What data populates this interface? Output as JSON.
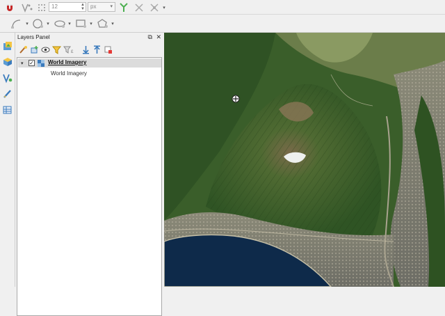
{
  "toolbar_top": {
    "size_value": "12",
    "unit_value": "px",
    "icons": [
      "magnet-icon",
      "vertex-tool-icon",
      "snap-grid-icon",
      "split-icon",
      "delete-x-icon",
      "merge-icon"
    ]
  },
  "toolbar_second": {
    "icons": [
      "draw-line-icon",
      "draw-circle-icon",
      "draw-ellipse-icon",
      "draw-rectangle-icon",
      "draw-polygon-icon"
    ]
  },
  "layers_panel": {
    "title": "Layers Panel",
    "tools": [
      "style-icon",
      "add-group-icon",
      "visibility-icon",
      "filter-icon",
      "expression-filter-icon",
      "expand-all-icon",
      "collapse-all-icon",
      "remove-layer-icon"
    ],
    "layers": [
      {
        "name": "World Imagery",
        "checked": true,
        "sublabel": "World Imagery"
      }
    ]
  },
  "colors": {
    "accent_green": "#4caf50",
    "selection": "#dcdcdc",
    "map_sea": "#0e2a4a",
    "map_forest": "#3e6b2c"
  }
}
